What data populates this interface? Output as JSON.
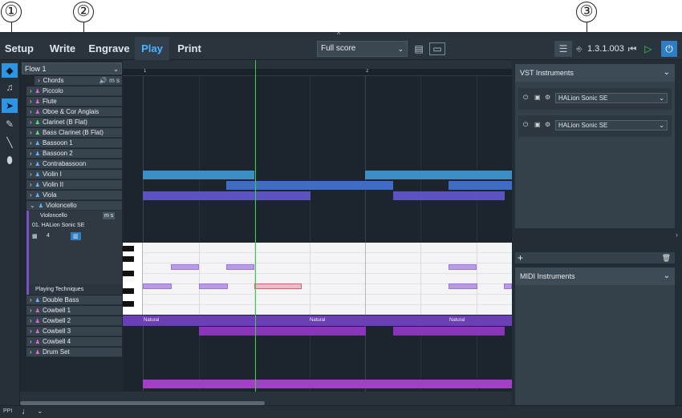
{
  "callouts": [
    "①",
    "②",
    "③"
  ],
  "top_arrow": "^",
  "mode_tabs": [
    "Setup",
    "Write",
    "Engrave",
    "Play",
    "Print"
  ],
  "layout_select": "Full score",
  "version": "1.3.1.003",
  "flow_select": "Flow 1",
  "bar_numbers": [
    "1",
    "2"
  ],
  "tracks": {
    "chords": "Chords",
    "piccolo": "Piccolo",
    "flute": "Flute",
    "oboe": "Oboe & Cor Anglais",
    "clarinet": "Clarinet (B Flat)",
    "bass_clarinet": "Bass Clarinet (B Flat)",
    "bassoon1": "Bassoon 1",
    "bassoon2": "Bassoon 2",
    "contrabassoon": "Contrabassoon",
    "violin1": "Violin I",
    "violin2": "Violin II",
    "viola": "Viola",
    "violoncello": "Violoncello",
    "double_bass": "Double Bass",
    "cowbell1": "Cowbell 1",
    "cowbell2": "Cowbell 2",
    "cowbell3": "Cowbell 3",
    "cowbell4": "Cowbell 4",
    "drum_set": "Drum Set"
  },
  "cello_panel": {
    "name": "Violoncello",
    "ms": "m s",
    "instrument": "01. HALion Sonic SE",
    "channel": "4"
  },
  "playing_techniques_label": "Playing Techniques",
  "technique_labels": [
    "Natural",
    "Natural",
    "Natural"
  ],
  "vst_panel": {
    "title": "VST Instruments",
    "instruments": [
      "HALion Sonic SE",
      "HALion Sonic SE"
    ]
  },
  "midi_panel": {
    "title": "MIDI Instruments"
  },
  "add_symbol": "+",
  "trash_symbol": "🗑",
  "bottom_label": "PPI"
}
